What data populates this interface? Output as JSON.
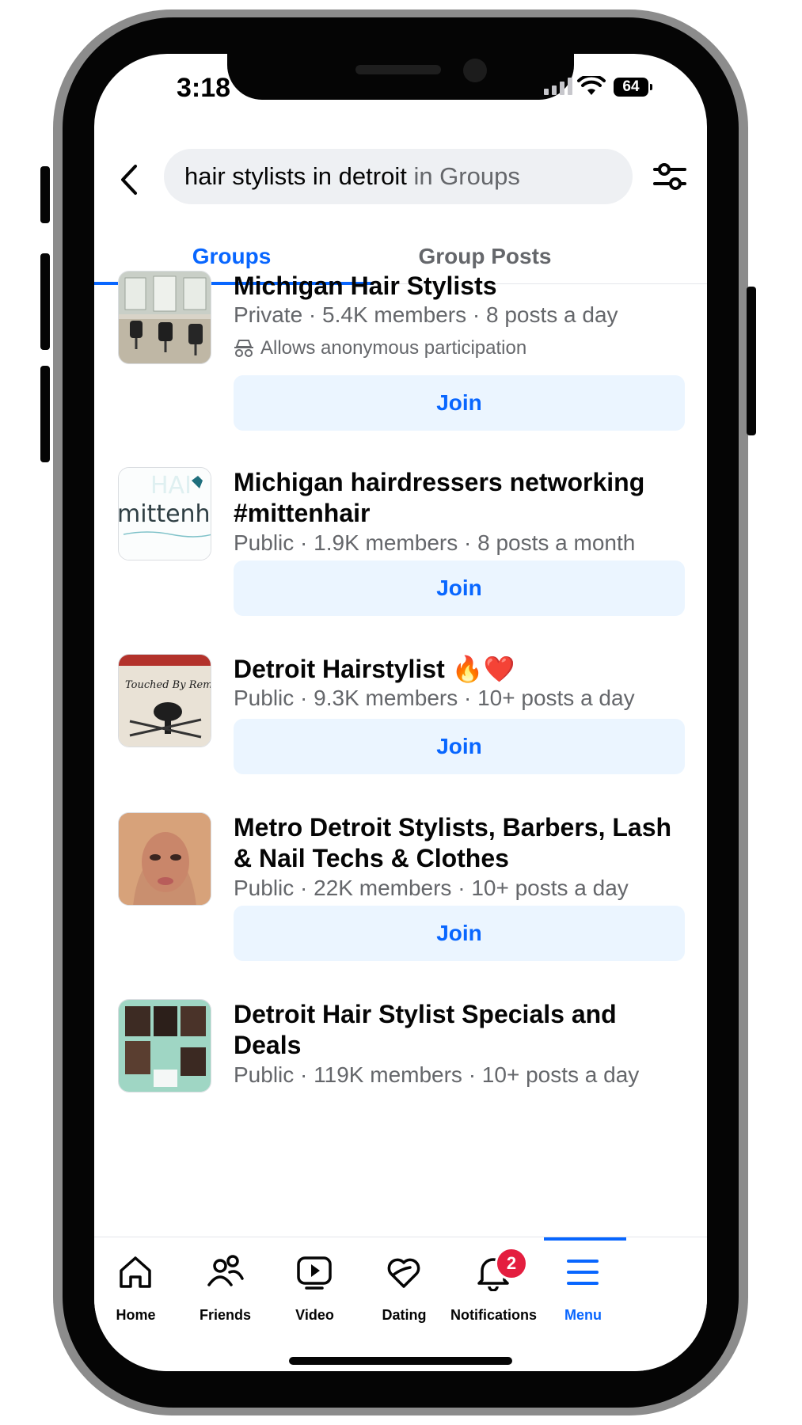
{
  "status_bar": {
    "time": "3:18",
    "battery": "64"
  },
  "search": {
    "query": "hair stylists in detroit",
    "scope": " in Groups"
  },
  "tabs": [
    {
      "label": "Groups",
      "active": true
    },
    {
      "label": "Group Posts",
      "active": false
    }
  ],
  "groups": [
    {
      "name": "Michigan Hair Stylists",
      "meta": "Private · 5.4K members · 8 posts a day",
      "note": "Allows anonymous participation",
      "join_label": "Join"
    },
    {
      "name": "Michigan hairdressers networking #mittenhair",
      "meta": "Public · 1.9K members · 8 posts a month",
      "join_label": "Join",
      "thumb_text": "mittenh"
    },
    {
      "name": "Detroit Hairstylist 🔥❤️",
      "meta": "Public · 9.3K members · 10+ posts a day",
      "join_label": "Join",
      "thumb_text": "Touched By Remy"
    },
    {
      "name": "Metro Detroit Stylists, Barbers, Lash & Nail Techs & Clothes",
      "meta": "Public · 22K members · 10+ posts a day",
      "join_label": "Join"
    },
    {
      "name": "Detroit Hair Stylist Specials and Deals",
      "meta": "Public · 119K members · 10+ posts a day"
    }
  ],
  "bottom_nav": [
    {
      "label": "Home",
      "icon": "home-icon"
    },
    {
      "label": "Friends",
      "icon": "friends-icon"
    },
    {
      "label": "Video",
      "icon": "video-icon"
    },
    {
      "label": "Dating",
      "icon": "dating-icon"
    },
    {
      "label": "Notifications",
      "icon": "bell-icon",
      "badge": "2"
    },
    {
      "label": "Menu",
      "icon": "menu-icon",
      "active": true
    }
  ],
  "colors": {
    "accent": "#0866ff",
    "join_bg": "#ebf5ff",
    "badge": "#e41e3f",
    "secondary_text": "#65676b"
  }
}
